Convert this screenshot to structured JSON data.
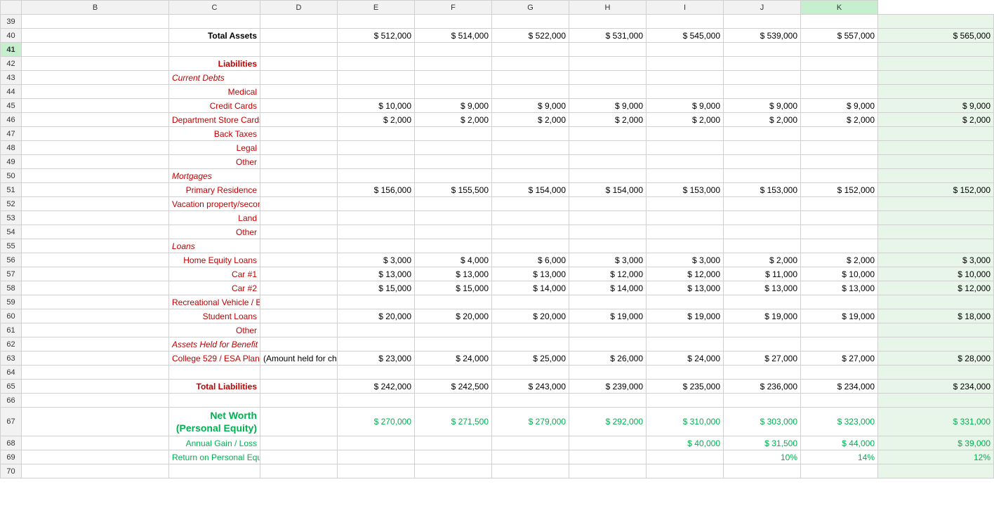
{
  "columns": [
    "A",
    "B",
    "C",
    "D",
    "E",
    "F",
    "G",
    "H",
    "I",
    "J",
    "K"
  ],
  "rows": [
    {
      "num": 39,
      "cells": [
        "",
        "",
        "",
        "",
        "",
        "",
        "",
        "",
        "",
        "",
        ""
      ]
    },
    {
      "num": 40,
      "b": {
        "text": "Total Assets",
        "class": "text-right bold"
      },
      "d": {
        "text": "$ 512,000",
        "class": "text-right"
      },
      "e": {
        "text": "$ 514,000",
        "class": "text-right"
      },
      "f": {
        "text": "$ 522,000",
        "class": "text-right"
      },
      "g": {
        "text": "$ 531,000",
        "class": "text-right"
      },
      "h": {
        "text": "$ 545,000",
        "class": "text-right"
      },
      "i": {
        "text": "$ 539,000",
        "class": "text-right"
      },
      "j": {
        "text": "$ 557,000",
        "class": "text-right"
      },
      "k": {
        "text": "$ 565,000",
        "class": "text-right"
      }
    },
    {
      "num": 41,
      "selected": true,
      "cells": [
        "",
        "",
        "",
        "",
        "",
        "",
        "",
        "",
        "",
        "",
        ""
      ]
    },
    {
      "num": 42,
      "b": {
        "text": "Liabilities",
        "class": "text-right dark-red-bold"
      }
    },
    {
      "num": 43,
      "b": {
        "text": "Current Debts",
        "class": "text-left italic-red"
      }
    },
    {
      "num": 44,
      "b": {
        "text": "Medical",
        "class": "text-right red-text"
      }
    },
    {
      "num": 45,
      "b": {
        "text": "Credit Cards",
        "class": "text-right red-text"
      },
      "d": {
        "text": "$       10,000",
        "class": "text-right"
      },
      "e": {
        "text": "$       9,000",
        "class": "text-right"
      },
      "f": {
        "text": "$       9,000",
        "class": "text-right"
      },
      "g": {
        "text": "$       9,000",
        "class": "text-right"
      },
      "h": {
        "text": "$       9,000",
        "class": "text-right"
      },
      "i": {
        "text": "$       9,000",
        "class": "text-right"
      },
      "j": {
        "text": "$       9,000",
        "class": "text-right"
      },
      "k": {
        "text": "$       9,000",
        "class": "text-right"
      }
    },
    {
      "num": 46,
      "b": {
        "text": "Department Store Cards",
        "class": "text-right red-text"
      },
      "d": {
        "text": "$       2,000",
        "class": "text-right"
      },
      "e": {
        "text": "$       2,000",
        "class": "text-right"
      },
      "f": {
        "text": "$       2,000",
        "class": "text-right"
      },
      "g": {
        "text": "$       2,000",
        "class": "text-right"
      },
      "h": {
        "text": "$       2,000",
        "class": "text-right"
      },
      "i": {
        "text": "$       2,000",
        "class": "text-right"
      },
      "j": {
        "text": "$       2,000",
        "class": "text-right"
      },
      "k": {
        "text": "$       2,000",
        "class": "text-right"
      }
    },
    {
      "num": 47,
      "b": {
        "text": "Back Taxes",
        "class": "text-right red-text"
      }
    },
    {
      "num": 48,
      "b": {
        "text": "Legal",
        "class": "text-right red-text"
      }
    },
    {
      "num": 49,
      "b": {
        "text": "Other",
        "class": "text-right red-text"
      }
    },
    {
      "num": 50,
      "b": {
        "text": "Mortgages",
        "class": "text-left italic-red"
      }
    },
    {
      "num": 51,
      "b": {
        "text": "Primary Residence",
        "class": "text-right red-text"
      },
      "d": {
        "text": "$     156,000",
        "class": "text-right"
      },
      "e": {
        "text": "$     155,500",
        "class": "text-right"
      },
      "f": {
        "text": "$     154,000",
        "class": "text-right"
      },
      "g": {
        "text": "$     154,000",
        "class": "text-right"
      },
      "h": {
        "text": "$     153,000",
        "class": "text-right"
      },
      "i": {
        "text": "$     153,000",
        "class": "text-right"
      },
      "j": {
        "text": "$     152,000",
        "class": "text-right"
      },
      "k": {
        "text": "$     152,000",
        "class": "text-right"
      }
    },
    {
      "num": 52,
      "b": {
        "text": "Vacation property/second Home",
        "class": "text-right red-text"
      }
    },
    {
      "num": 53,
      "b": {
        "text": "Land",
        "class": "text-right red-text"
      }
    },
    {
      "num": 54,
      "b": {
        "text": "Other",
        "class": "text-right red-text"
      }
    },
    {
      "num": 55,
      "b": {
        "text": "Loans",
        "class": "text-left italic-red"
      }
    },
    {
      "num": 56,
      "b": {
        "text": "Home Equity Loans",
        "class": "text-right red-text"
      },
      "d": {
        "text": "$       3,000",
        "class": "text-right"
      },
      "e": {
        "text": "$       4,000",
        "class": "text-right"
      },
      "f": {
        "text": "$       6,000",
        "class": "text-right"
      },
      "g": {
        "text": "$       3,000",
        "class": "text-right"
      },
      "h": {
        "text": "$       3,000",
        "class": "text-right"
      },
      "i": {
        "text": "$       2,000",
        "class": "text-right"
      },
      "j": {
        "text": "$       2,000",
        "class": "text-right"
      },
      "k": {
        "text": "$       3,000",
        "class": "text-right"
      }
    },
    {
      "num": 57,
      "b": {
        "text": "Car #1",
        "class": "text-right red-text"
      },
      "d": {
        "text": "$     13,000",
        "class": "text-right"
      },
      "e": {
        "text": "$     13,000",
        "class": "text-right"
      },
      "f": {
        "text": "$     13,000",
        "class": "text-right"
      },
      "g": {
        "text": "$     12,000",
        "class": "text-right"
      },
      "h": {
        "text": "$     12,000",
        "class": "text-right"
      },
      "i": {
        "text": "$     11,000",
        "class": "text-right"
      },
      "j": {
        "text": "$     10,000",
        "class": "text-right"
      },
      "k": {
        "text": "$     10,000",
        "class": "text-right"
      }
    },
    {
      "num": 58,
      "b": {
        "text": "Car #2",
        "class": "text-right red-text"
      },
      "d": {
        "text": "$     15,000",
        "class": "text-right"
      },
      "e": {
        "text": "$     15,000",
        "class": "text-right"
      },
      "f": {
        "text": "$     14,000",
        "class": "text-right"
      },
      "g": {
        "text": "$     14,000",
        "class": "text-right"
      },
      "h": {
        "text": "$     13,000",
        "class": "text-right"
      },
      "i": {
        "text": "$     13,000",
        "class": "text-right"
      },
      "j": {
        "text": "$     13,000",
        "class": "text-right"
      },
      "k": {
        "text": "$     12,000",
        "class": "text-right"
      }
    },
    {
      "num": 59,
      "b": {
        "text": "Recreational Vehicle / Boat",
        "class": "text-right red-text"
      }
    },
    {
      "num": 60,
      "b": {
        "text": "Student Loans",
        "class": "text-right red-text"
      },
      "d": {
        "text": "$     20,000",
        "class": "text-right"
      },
      "e": {
        "text": "$     20,000",
        "class": "text-right"
      },
      "f": {
        "text": "$     20,000",
        "class": "text-right"
      },
      "g": {
        "text": "$     19,000",
        "class": "text-right"
      },
      "h": {
        "text": "$     19,000",
        "class": "text-right"
      },
      "i": {
        "text": "$     19,000",
        "class": "text-right"
      },
      "j": {
        "text": "$     19,000",
        "class": "text-right"
      },
      "k": {
        "text": "$     18,000",
        "class": "text-right"
      }
    },
    {
      "num": 61,
      "b": {
        "text": "Other",
        "class": "text-right red-text"
      }
    },
    {
      "num": 62,
      "b": {
        "text": "Assets Held for Benefit of Others",
        "class": "text-left italic-red"
      }
    },
    {
      "num": 63,
      "b": {
        "text": "College 529 / ESA Plans",
        "class": "text-right red-text"
      },
      "c": {
        "text": "(Amount held for children.",
        "class": "text-left"
      },
      "d": {
        "text": "$     23,000",
        "class": "text-right"
      },
      "e": {
        "text": "$     24,000",
        "class": "text-right"
      },
      "f": {
        "text": "$     25,000",
        "class": "text-right"
      },
      "g": {
        "text": "$     26,000",
        "class": "text-right"
      },
      "h": {
        "text": "$     24,000",
        "class": "text-right"
      },
      "i": {
        "text": "$     27,000",
        "class": "text-right"
      },
      "j": {
        "text": "$     27,000",
        "class": "text-right"
      },
      "k": {
        "text": "$     28,000",
        "class": "text-right"
      }
    },
    {
      "num": 64,
      "cells": [
        "",
        "",
        "",
        "",
        "",
        "",
        "",
        "",
        "",
        "",
        ""
      ]
    },
    {
      "num": 65,
      "b": {
        "text": "Total Liabilities",
        "class": "text-right dark-red-bold"
      },
      "d": {
        "text": "$ 242,000",
        "class": "text-right"
      },
      "e": {
        "text": "$ 242,500",
        "class": "text-right"
      },
      "f": {
        "text": "$ 243,000",
        "class": "text-right"
      },
      "g": {
        "text": "$ 239,000",
        "class": "text-right"
      },
      "h": {
        "text": "$ 235,000",
        "class": "text-right"
      },
      "i": {
        "text": "$ 236,000",
        "class": "text-right"
      },
      "j": {
        "text": "$ 234,000",
        "class": "text-right"
      },
      "k": {
        "text": "$ 234,000",
        "class": "text-right"
      }
    },
    {
      "num": 66,
      "cells": [
        "",
        "",
        "",
        "",
        "",
        "",
        "",
        "",
        "",
        "",
        ""
      ]
    },
    {
      "num": 67,
      "b": {
        "text": "Net Worth (Personal Equity)",
        "class": "text-right green-text bold large"
      },
      "d": {
        "text": "$ 270,000",
        "class": "text-right green-text"
      },
      "e": {
        "text": "$ 271,500",
        "class": "text-right green-text"
      },
      "f": {
        "text": "$ 279,000",
        "class": "text-right green-text"
      },
      "g": {
        "text": "$ 292,000",
        "class": "text-right green-text"
      },
      "h": {
        "text": "$ 310,000",
        "class": "text-right green-text"
      },
      "i": {
        "text": "$ 303,000",
        "class": "text-right green-text"
      },
      "j": {
        "text": "$ 323,000",
        "class": "text-right green-text"
      },
      "k": {
        "text": "$ 331,000",
        "class": "text-right green-text"
      }
    },
    {
      "num": 68,
      "b": {
        "text": "Annual Gain / Loss",
        "class": "text-right green-text"
      },
      "h": {
        "text": "$ 40,000",
        "class": "text-right green-text"
      },
      "i": {
        "text": "$  31,500",
        "class": "text-right green-text"
      },
      "j": {
        "text": "$  44,000",
        "class": "text-right green-text"
      },
      "k": {
        "text": "$  39,000",
        "class": "text-right green-text"
      }
    },
    {
      "num": 69,
      "b": {
        "text": "Return on Personal Equity",
        "class": "text-right green-text"
      },
      "i": {
        "text": "10%",
        "class": "text-right green-text"
      },
      "j": {
        "text": "14%",
        "class": "text-right green-text"
      },
      "k": {
        "text": "12%",
        "class": "text-right green-text"
      }
    },
    {
      "num": 70,
      "cells": [
        "",
        "",
        "",
        "",
        "",
        "",
        "",
        "",
        "",
        "",
        ""
      ]
    }
  ]
}
